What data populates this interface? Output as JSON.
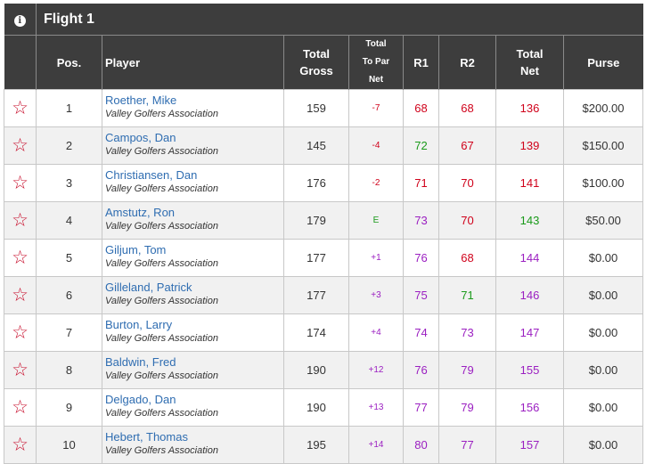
{
  "flight": {
    "title": "Flight 1",
    "info_icon": "info-circle-icon"
  },
  "columns": {
    "pos": "Pos.",
    "player": "Player",
    "total_gross": [
      "Total",
      "Gross"
    ],
    "total_to_par": [
      "Total",
      "To Par",
      "Net"
    ],
    "r1": "R1",
    "r2": "R2",
    "total_net": [
      "Total",
      "Net"
    ],
    "purse": "Purse"
  },
  "colors": {
    "red": "#d0021b",
    "green": "#1a9a1a",
    "purple": "#9b1fc1",
    "link": "#2f6db1",
    "header": "#3d3d3d"
  },
  "rows": [
    {
      "pos": "1",
      "name": "Roether, Mike",
      "club": "Valley Golfers Association",
      "gross": "159",
      "to_par": "-7",
      "to_par_color": "red",
      "r1": "68",
      "r1_color": "red",
      "r2": "68",
      "r2_color": "red",
      "net": "136",
      "net_color": "red",
      "purse": "$200.00"
    },
    {
      "pos": "2",
      "name": "Campos, Dan",
      "club": "Valley Golfers Association",
      "gross": "145",
      "to_par": "-4",
      "to_par_color": "red",
      "r1": "72",
      "r1_color": "green",
      "r2": "67",
      "r2_color": "red",
      "net": "139",
      "net_color": "red",
      "purse": "$150.00"
    },
    {
      "pos": "3",
      "name": "Christiansen, Dan",
      "club": "Valley Golfers Association",
      "gross": "176",
      "to_par": "-2",
      "to_par_color": "red",
      "r1": "71",
      "r1_color": "red",
      "r2": "70",
      "r2_color": "red",
      "net": "141",
      "net_color": "red",
      "purse": "$100.00"
    },
    {
      "pos": "4",
      "name": "Amstutz, Ron",
      "club": "Valley Golfers Association",
      "gross": "179",
      "to_par": "E",
      "to_par_color": "green",
      "r1": "73",
      "r1_color": "purple",
      "r2": "70",
      "r2_color": "red",
      "net": "143",
      "net_color": "green",
      "purse": "$50.00"
    },
    {
      "pos": "5",
      "name": "Giljum, Tom",
      "club": "Valley Golfers Association",
      "gross": "177",
      "to_par": "+1",
      "to_par_color": "purple",
      "r1": "76",
      "r1_color": "purple",
      "r2": "68",
      "r2_color": "red",
      "net": "144",
      "net_color": "purple",
      "purse": "$0.00"
    },
    {
      "pos": "6",
      "name": "Gilleland, Patrick",
      "club": "Valley Golfers Association",
      "gross": "177",
      "to_par": "+3",
      "to_par_color": "purple",
      "r1": "75",
      "r1_color": "purple",
      "r2": "71",
      "r2_color": "green",
      "net": "146",
      "net_color": "purple",
      "purse": "$0.00"
    },
    {
      "pos": "7",
      "name": "Burton, Larry",
      "club": "Valley Golfers Association",
      "gross": "174",
      "to_par": "+4",
      "to_par_color": "purple",
      "r1": "74",
      "r1_color": "purple",
      "r2": "73",
      "r2_color": "purple",
      "net": "147",
      "net_color": "purple",
      "purse": "$0.00"
    },
    {
      "pos": "8",
      "name": "Baldwin, Fred",
      "club": "Valley Golfers Association",
      "gross": "190",
      "to_par": "+12",
      "to_par_color": "purple",
      "r1": "76",
      "r1_color": "purple",
      "r2": "79",
      "r2_color": "purple",
      "net": "155",
      "net_color": "purple",
      "purse": "$0.00"
    },
    {
      "pos": "9",
      "name": "Delgado, Dan",
      "club": "Valley Golfers Association",
      "gross": "190",
      "to_par": "+13",
      "to_par_color": "purple",
      "r1": "77",
      "r1_color": "purple",
      "r2": "79",
      "r2_color": "purple",
      "net": "156",
      "net_color": "purple",
      "purse": "$0.00"
    },
    {
      "pos": "10",
      "name": "Hebert, Thomas",
      "club": "Valley Golfers Association",
      "gross": "195",
      "to_par": "+14",
      "to_par_color": "purple",
      "r1": "80",
      "r1_color": "purple",
      "r2": "77",
      "r2_color": "purple",
      "net": "157",
      "net_color": "purple",
      "purse": "$0.00"
    }
  ],
  "row_icon": "star-outline-icon"
}
